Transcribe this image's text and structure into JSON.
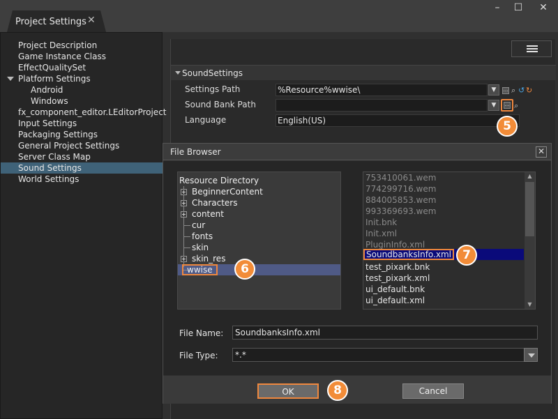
{
  "window": {
    "tab_title": "Project Settings",
    "tab_close_icon": "close-icon",
    "controls": [
      "minimize-icon",
      "maximize-icon",
      "close-icon"
    ]
  },
  "sidebar": {
    "items": [
      {
        "label": "Project Description"
      },
      {
        "label": "Game Instance Class"
      },
      {
        "label": "EffectQualitySet"
      },
      {
        "label": "Platform Settings"
      },
      {
        "label": "Android"
      },
      {
        "label": "Windows"
      },
      {
        "label": "fx_component_editor.LEditorProject"
      },
      {
        "label": "Input Settings"
      },
      {
        "label": "Packaging Settings"
      },
      {
        "label": "General Project Settings"
      },
      {
        "label": "Server Class Map"
      },
      {
        "label": "Sound Settings"
      },
      {
        "label": "World Settings"
      }
    ],
    "selected": "Sound Settings"
  },
  "sound_settings": {
    "section_title": "SoundSettings",
    "settings_path_label": "Settings Path",
    "settings_path_value": "%Resource%wwise\\",
    "sound_bank_path_label": "Sound Bank Path",
    "sound_bank_path_value": "",
    "language_label": "Language",
    "language_value": "English(US)"
  },
  "file_browser": {
    "title": "File Browser",
    "tree_root": "Resource Directory",
    "tree": [
      {
        "label": "BeginnerContent",
        "expandable": true
      },
      {
        "label": "Characters",
        "expandable": true
      },
      {
        "label": "content",
        "expandable": true
      },
      {
        "label": "cur",
        "expandable": false
      },
      {
        "label": "fonts",
        "expandable": false
      },
      {
        "label": "skin",
        "expandable": false
      },
      {
        "label": "skin_res",
        "expandable": true
      },
      {
        "label": "wwise",
        "expandable": false
      }
    ],
    "selected_folder": "wwise",
    "files": [
      "753410061.wem",
      "774299716.wem",
      "884005853.wem",
      "993369693.wem",
      "Init.bnk",
      "Init.xml",
      "PluginInfo.xml",
      "SoundbanksInfo.xml",
      "test_pixark.bnk",
      "test_pixark.xml",
      "ui_default.bnk",
      "ui_default.xml"
    ],
    "selected_file": "SoundbanksInfo.xml",
    "file_name_label": "File Name:",
    "file_name_value": "SoundbanksInfo.xml",
    "file_type_label": "File Type:",
    "file_type_value": "*.*",
    "ok_label": "OK",
    "cancel_label": "Cancel"
  },
  "badges": {
    "b5": "5",
    "b6": "6",
    "b7": "7",
    "b8": "8"
  },
  "colors": {
    "accent": "#f28c38",
    "selection": "#3f6278",
    "file_selection": "#0a0a7a"
  }
}
